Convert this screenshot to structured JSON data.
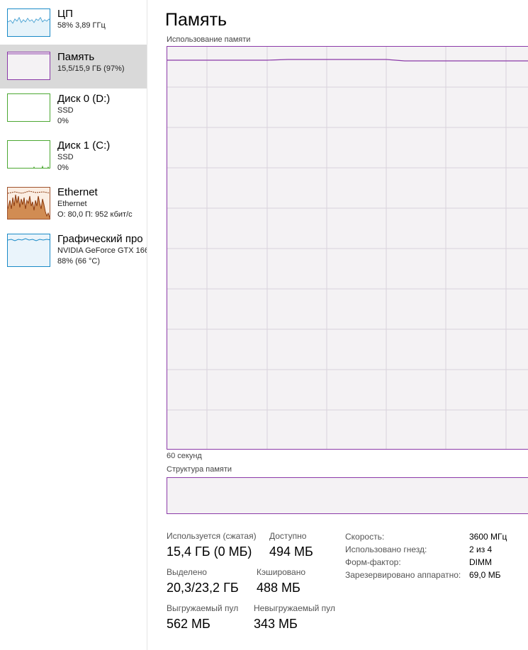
{
  "sidebar": {
    "items": [
      {
        "title": "ЦП",
        "line1": "58% 3,89 ГГц",
        "line2": "",
        "selected": false,
        "color": "#1a8ac7",
        "icon": "cpu-graph-thumbnail"
      },
      {
        "title": "Память",
        "line1": "15,5/15,9 ГБ (97%)",
        "line2": "",
        "selected": true,
        "color": "#8b3aa8",
        "icon": "memory-graph-thumbnail"
      },
      {
        "title": "Диск 0 (D:)",
        "line1": "SSD",
        "line2": "0%",
        "selected": false,
        "color": "#4ca832",
        "icon": "disk-graph-thumbnail"
      },
      {
        "title": "Диск 1 (C:)",
        "line1": "SSD",
        "line2": "0%",
        "selected": false,
        "color": "#4ca832",
        "icon": "disk-graph-thumbnail"
      },
      {
        "title": "Ethernet",
        "line1": "Ethernet",
        "line2": "О: 80,0  П: 952 кбит/с",
        "selected": false,
        "color": "#a0522d",
        "icon": "ethernet-graph-thumbnail"
      },
      {
        "title": "Графический про",
        "line1": "NVIDIA GeForce GTX 166",
        "line2": "88% (66 °C)",
        "selected": false,
        "color": "#1a8ac7",
        "icon": "gpu-graph-thumbnail"
      }
    ]
  },
  "main": {
    "title": "Память",
    "graph_label": "Использование памяти",
    "graph_time": "60 секунд",
    "structure_label": "Структура памяти",
    "usage_percent": 97
  },
  "stats": {
    "in_use_label": "Используется (сжатая)",
    "in_use_value": "15,4 ГБ (0 МБ)",
    "available_label": "Доступно",
    "available_value": "494 МБ",
    "committed_label": "Выделено",
    "committed_value": "20,3/23,2 ГБ",
    "cached_label": "Кэшировано",
    "cached_value": "488 МБ",
    "paged_label": "Выгружаемый пул",
    "paged_value": "562 МБ",
    "nonpaged_label": "Невыгружаемый пул",
    "nonpaged_value": "343 МБ"
  },
  "properties": {
    "speed_label": "Скорость:",
    "speed_value": "3600 МГц",
    "slots_label": "Использовано гнезд:",
    "slots_value": "2 из 4",
    "form_label": "Форм-фактор:",
    "form_value": "DIMM",
    "reserved_label": "Зарезервировано аппаратно:",
    "reserved_value": "69,0 МБ"
  },
  "colors": {
    "memory_accent": "#8b3aa8",
    "graph_bg": "#f4f2f4",
    "selected_bg": "#d9d9d9"
  }
}
